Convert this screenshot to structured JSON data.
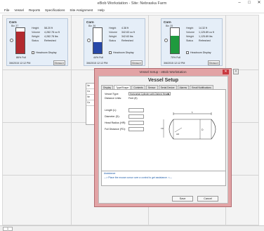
{
  "app": {
    "title": "eBob Workstation - Site: Nebraska Farm",
    "win_min": "–",
    "win_max": "□",
    "win_close": "✕"
  },
  "menu": [
    "File",
    "Vessel",
    "Reports",
    "Specifications",
    "Site Assignment",
    "Help"
  ],
  "cards": [
    {
      "name": "Corn",
      "level": "Bin 37",
      "rows": [
        [
          "Height",
          "58.20 ft"
        ],
        [
          "Volume",
          "4,282.78 cu ft"
        ],
        [
          "Weight",
          "4,282.78 lbs"
        ],
        [
          "Status",
          "Refreshed"
        ]
      ],
      "headroom": "Headroom Display",
      "percent": "86% Full",
      "time": "3/6/2015 12:12 PM",
      "button": "Measure",
      "fill_fraction": 0.86,
      "color": "#b22a2f"
    },
    {
      "name": "Corn",
      "level": "Bin 36",
      "rows": [
        [
          "Height",
          "4.38 ft"
        ],
        [
          "Volume",
          "342.63 cu ft"
        ],
        [
          "Weight",
          "342.63 lbs"
        ],
        [
          "Status",
          "Refreshed"
        ]
      ],
      "headroom": "Headroom Display",
      "percent": "44% Full",
      "time": "3/6/2015 12:12 PM",
      "button": "Measure",
      "fill_fraction": 0.44,
      "color": "#2748a8"
    },
    {
      "name": "Corn",
      "level": "Bin 35",
      "rows": [
        [
          "Height",
          "14.32 ft"
        ],
        [
          "Volume",
          "1,125.89 cu ft"
        ],
        [
          "Weight",
          "1,125.89 lbs"
        ],
        [
          "Status",
          "Refreshed"
        ]
      ],
      "headroom": "Headroom Display",
      "percent": "70% Full",
      "time": "3/6/2015 12:12 PM",
      "button": "Measure",
      "fill_fraction": 0.7,
      "color": "#1f9a3e"
    }
  ],
  "backpanel": [
    "Ve",
    "Co",
    "Ve",
    "Co"
  ],
  "dialog": {
    "title": "Vessel Setup - eBob Workstation",
    "heading": "Vessel Setup",
    "close": "✕",
    "tabs": [
      "Display",
      "Type/Shape",
      "Contents",
      "Sensor",
      "Serial Device",
      "Alarms",
      "Email Notifications"
    ],
    "vessel_type_label": "Vessel Type:",
    "vessel_type_value": "Horizontal Cylinder with Dished Heads",
    "distance_units_label": "Distance Units:",
    "distance_units_value": "Feet (ft)",
    "fields": [
      "Length (L):",
      "Diameter (D):",
      "Head Radius (HR):",
      "Full Distance (FD):"
    ],
    "diagram_labels": {
      "L": "L",
      "D": "D",
      "HR": "HR",
      "FD": "FD"
    },
    "assistance_title": "Assistance",
    "assistance_text": "---> Place the mouse cursor over a control to get assistance. <---",
    "save": "Save",
    "cancel": "Cancel"
  },
  "pager": "1"
}
